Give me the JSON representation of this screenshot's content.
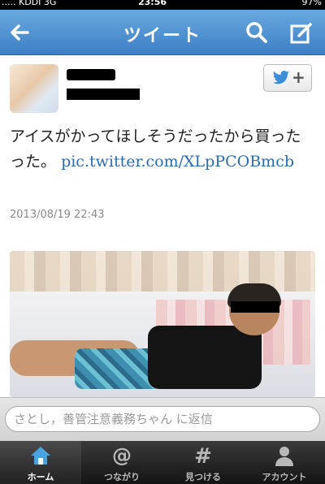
{
  "status_bar": {
    "carrier": "..... KDDI 3G",
    "time": "23:56",
    "battery": "97%"
  },
  "navbar": {
    "title": "ツイート",
    "back_icon": "arrow-left-icon",
    "search_icon": "search-icon",
    "compose_icon": "compose-icon"
  },
  "tweet": {
    "text": "アイスがかってほしそうだったから買ったった。",
    "link": "pic.twitter.com/XLpPCOBmcb",
    "date": "2013/08/19 22:43",
    "follow_icon": "twitter-bird-plus-icon"
  },
  "reply": {
    "placeholder": "さとし，善管注意義務ちゃん に返信"
  },
  "tabs": [
    {
      "label": "ホーム",
      "icon": "home-icon",
      "active": true
    },
    {
      "label": "つながり",
      "icon": "at-icon",
      "active": false
    },
    {
      "label": "見つける",
      "icon": "hash-icon",
      "active": false
    },
    {
      "label": "アカウント",
      "icon": "person-icon",
      "active": false
    }
  ],
  "colors": {
    "nav_blue": "#4a8fd4",
    "link_blue": "#2b6cb0",
    "tab_active": "#4aa3df"
  }
}
